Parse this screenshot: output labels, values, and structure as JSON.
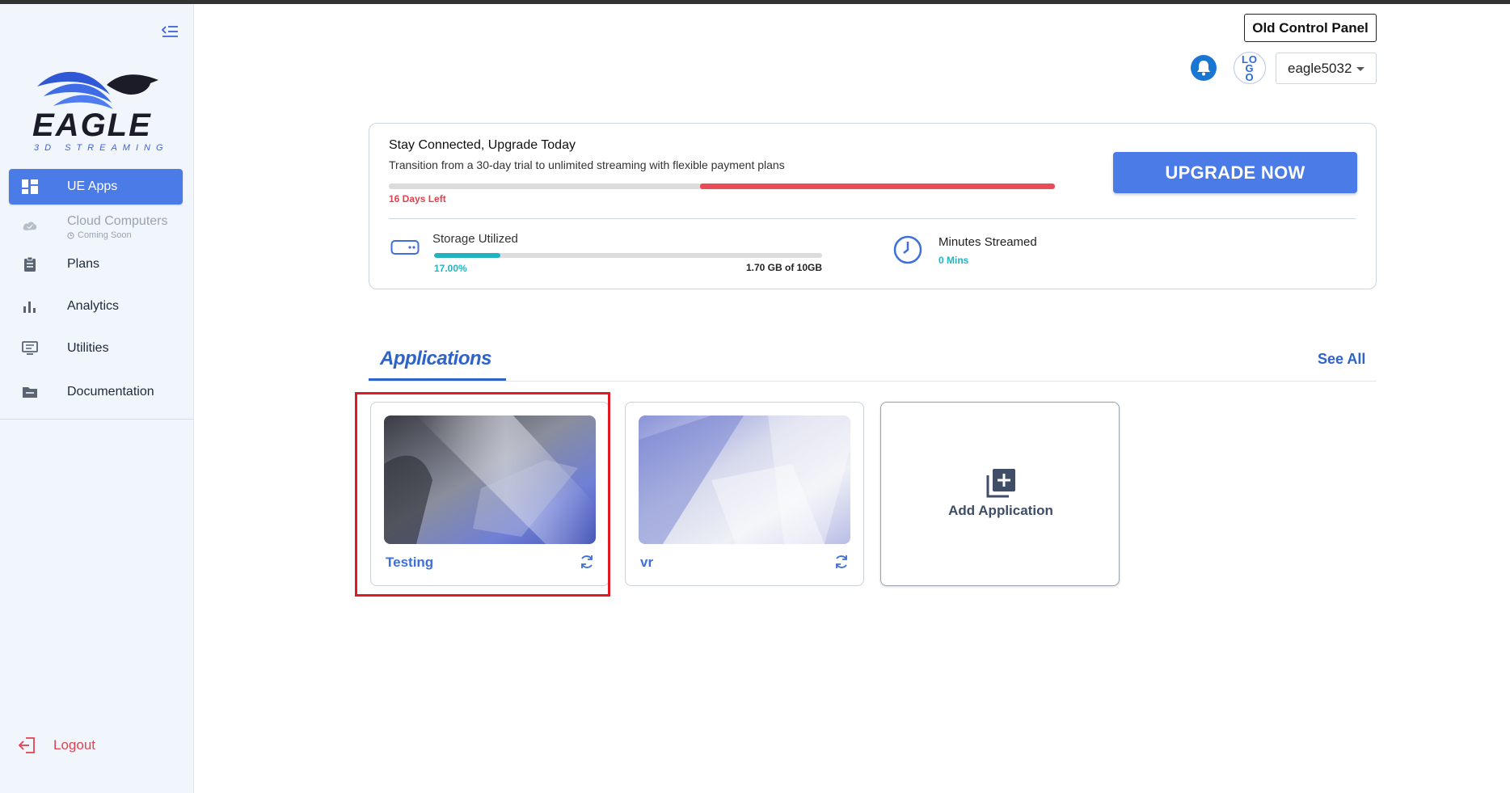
{
  "sidebar": {
    "logo_text": "EAGLE",
    "logo_sub": "3D STREAMING",
    "items": [
      {
        "label": "UE Apps",
        "icon": "dashboard-icon"
      },
      {
        "label": "Cloud Computers",
        "sub": "Coming Soon",
        "icon": "cloud-icon"
      },
      {
        "label": "Plans",
        "icon": "clipboard-icon"
      },
      {
        "label": "Analytics",
        "icon": "bar-chart-icon"
      },
      {
        "label": "Utilities",
        "icon": "monitor-icon"
      },
      {
        "label": "Documentation",
        "icon": "folder-icon"
      }
    ],
    "logout_label": "Logout"
  },
  "header": {
    "old_control_panel": "Old Control Panel",
    "avatar_text": "LOGO",
    "username": "eagle5032"
  },
  "upgrade": {
    "title": "Stay Connected, Upgrade Today",
    "description": "Transition from a 30-day trial to unlimited streaming with flexible payment plans",
    "days_left": "16 Days Left",
    "trial_remaining_fraction": 0.533,
    "button": "UPGRADE NOW",
    "storage_label": "Storage Utilized",
    "storage_percent_text": "17.00%",
    "storage_fraction": 0.17,
    "storage_amount": "1.70 GB of 10GB",
    "minutes_label": "Minutes Streamed",
    "minutes_value": "0 Mins"
  },
  "applications": {
    "tab_label": "Applications",
    "see_all": "See All",
    "apps": [
      {
        "name": "Testing"
      },
      {
        "name": "vr"
      }
    ],
    "add_label": "Add Application"
  },
  "colors": {
    "accent": "#4a7be6",
    "link": "#2e63c9",
    "danger": "#e2414f",
    "teal": "#22b3c3",
    "highlight": "#e01b24"
  }
}
